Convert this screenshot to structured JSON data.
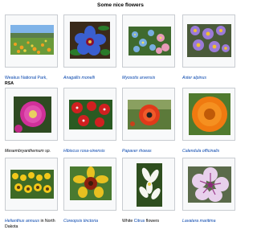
{
  "gallery": {
    "title": "Some nice flowers",
    "items": [
      {
        "link": "Weakus National Park,",
        "extra": "RSA",
        "image": "wildflower-field-photo"
      },
      {
        "link": "Anagallis monelli",
        "extra": "",
        "image": "blue-anagallis-photo"
      },
      {
        "link": "Myosotis arvensis",
        "extra": "",
        "image": "forget-me-not-photo"
      },
      {
        "link": "Aster alpinus",
        "extra": "",
        "image": "purple-aster-photo"
      },
      {
        "link": "",
        "plain": "Mesembryanthemum sp.",
        "image": "pink-mesembryanthemum-photo"
      },
      {
        "link": "Hibiscus rosa-sinensis",
        "extra": "",
        "image": "red-hibiscus-photo"
      },
      {
        "link": "Papaver rhoeas",
        "extra": "",
        "image": "red-poppy-photo"
      },
      {
        "link": "Calendula officinalis",
        "extra": "",
        "image": "orange-calendula-photo"
      },
      {
        "link": "Helianthus annuus",
        "extra": "in North Dakota",
        "image": "sunflower-field-photo"
      },
      {
        "link": "Coreopsis tinctoria",
        "extra": "",
        "image": "coreopsis-photo"
      },
      {
        "prefix": "White",
        "link": "Citrus",
        "extra": "flowers",
        "image": "white-citrus-flowers-photo"
      },
      {
        "link": "Lavatera maritima",
        "extra": "",
        "image": "lavatera-photo"
      }
    ]
  }
}
